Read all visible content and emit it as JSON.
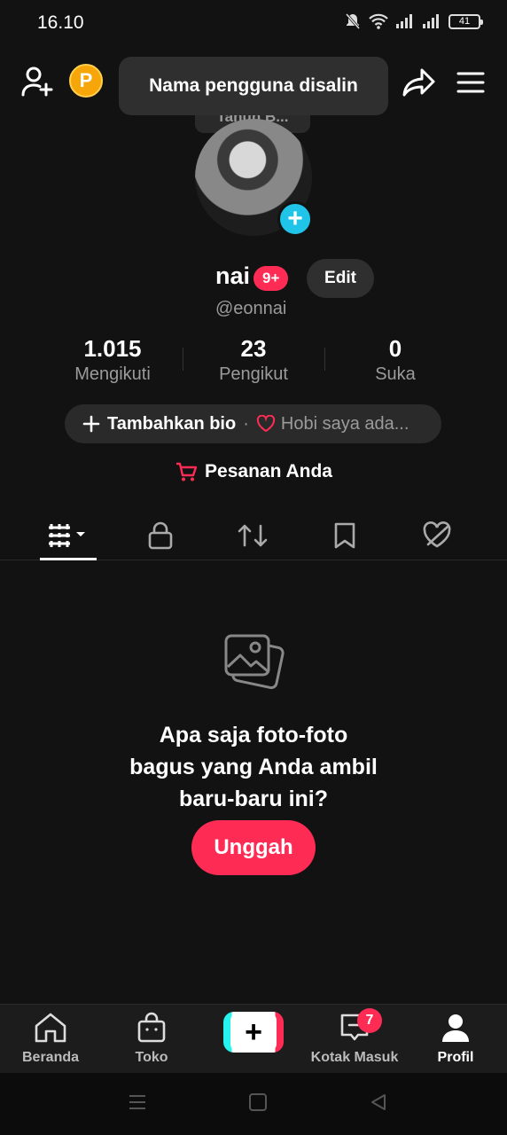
{
  "status_bar": {
    "time": "16.10",
    "battery": "41"
  },
  "toast": {
    "message": "Nama pengguna disalin"
  },
  "partial_label": "Tahun B...",
  "profile": {
    "name": "nai",
    "badge": "9+",
    "edit_label": "Edit",
    "handle": "@eonnai"
  },
  "stats": [
    {
      "value": "1.015",
      "label": "Mengikuti"
    },
    {
      "value": "23",
      "label": "Pengikut"
    },
    {
      "value": "0",
      "label": "Suka"
    }
  ],
  "bio": {
    "add_label": "Tambahkan bio",
    "separator": "·",
    "hint": "Hobi saya ada..."
  },
  "orders": {
    "label": "Pesanan Anda"
  },
  "empty_state": {
    "text": "Apa saja foto-foto\nbagus yang Anda ambil\nbaru-baru ini?",
    "button": "Unggah"
  },
  "bottom_nav": {
    "home": "Beranda",
    "shop": "Toko",
    "inbox": "Kotak Masuk",
    "inbox_badge": "7",
    "profile": "Profil"
  },
  "colors": {
    "accent": "#fe2c55",
    "cyan": "#20c4e8",
    "coin": "#f6a609",
    "background": "#121212"
  }
}
